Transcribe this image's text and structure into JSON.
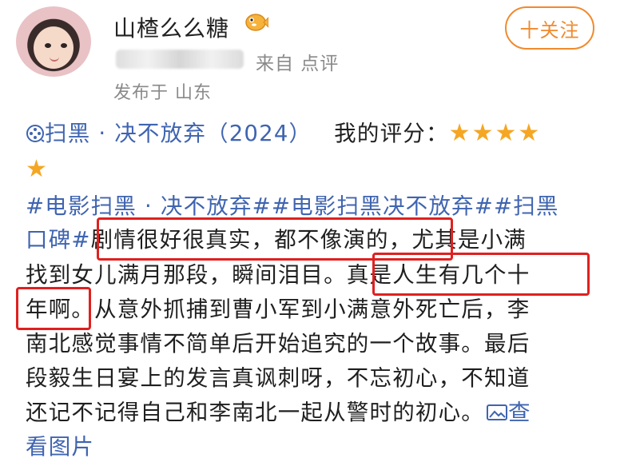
{
  "author": {
    "name": "山楂么么糖",
    "source_text": "来自 点评",
    "published_text": "发布于 山东",
    "follow_label": "十关注"
  },
  "review": {
    "movie_icon": "film-reel-icon",
    "movie_link": "扫黑 · 决不放弃（2024）",
    "rating_label": "我的评分：",
    "rating_stars": 5,
    "hashtags_line1": "#电影扫黑 · 决不放弃##电影扫黑决不放弃##扫黑",
    "hashtags_line2": "口碑#",
    "highlight1": "剧情很好很真实，都不像演的，",
    "text_after_highlight1": "尤其是小满",
    "line3_text": "找到女儿满月那段，瞬间泪目。",
    "highlight2_part1": "真是人生有几个十",
    "highlight2_part2": "年啊",
    "line4_rest": "。从意外抓捕到曹小军到小满意外死亡后，李",
    "line5": "南北感觉事情不简单后开始追究的一个故事。最后",
    "line6": "段毅生日宴上的发言真讽刺呀，不忘初心，不知道",
    "line7_text": "还记不记得自己和李南北一起从警时的初心。",
    "view_pics_part1": "查",
    "view_pics_part2": "看图片",
    "view_pics_icon": "image-icon"
  },
  "colors": {
    "link": "#3f64b0",
    "accent": "#f08a2e",
    "star": "#f5a623",
    "highlight_box": "#e02020"
  }
}
